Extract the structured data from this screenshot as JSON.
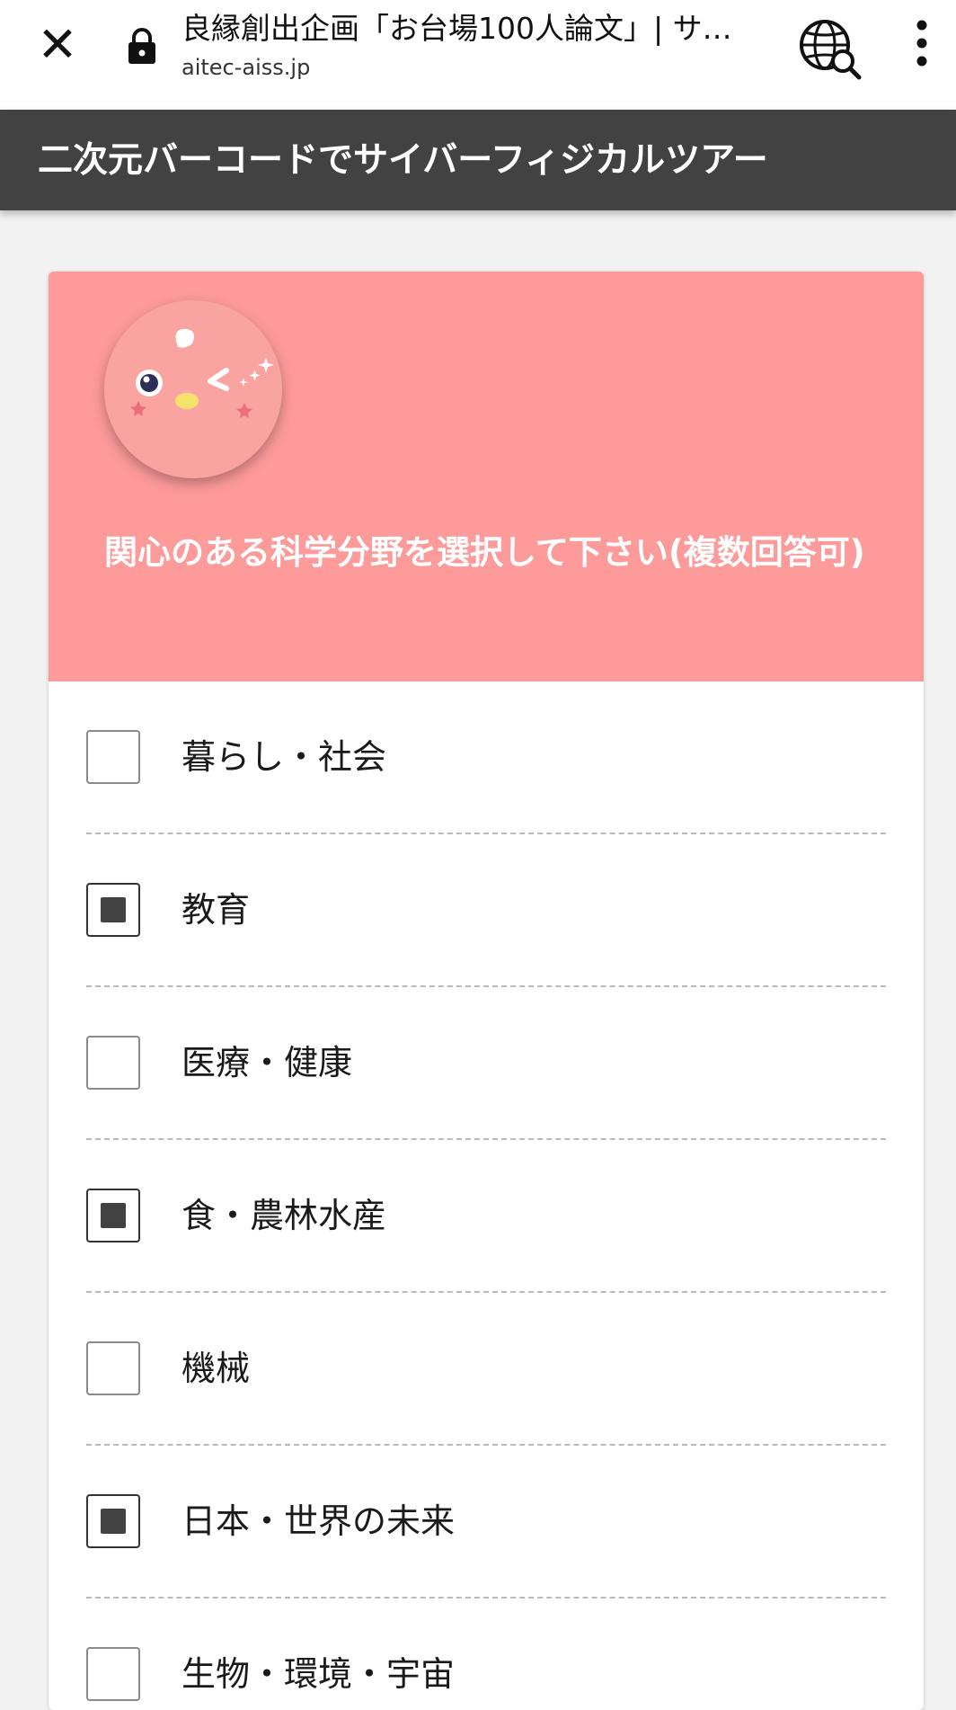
{
  "browser": {
    "title": "良縁創出企画「お台場100人論文」| サ…",
    "url": "aitec-aiss.jp",
    "close_icon": "close-icon",
    "lock_icon": "lock-icon",
    "globe_icon": "globe-search-icon",
    "menu_icon": "more-vert-icon"
  },
  "header": {
    "title": "二次元バーコードでサイバーフィジカルツアー"
  },
  "card": {
    "accent_color": "#fd9a9a",
    "mascot_icon": "mascot-avatar",
    "question": "関心のある科学分野を選択して下さい(複数回答可)",
    "options": [
      {
        "label": "暮らし・社会",
        "checked": false
      },
      {
        "label": "教育",
        "checked": true
      },
      {
        "label": "医療・健康",
        "checked": false
      },
      {
        "label": "食・農林水産",
        "checked": true
      },
      {
        "label": "機械",
        "checked": false
      },
      {
        "label": "日本・世界の未来",
        "checked": true
      },
      {
        "label": "生物・環境・宇宙",
        "checked": false
      }
    ]
  }
}
